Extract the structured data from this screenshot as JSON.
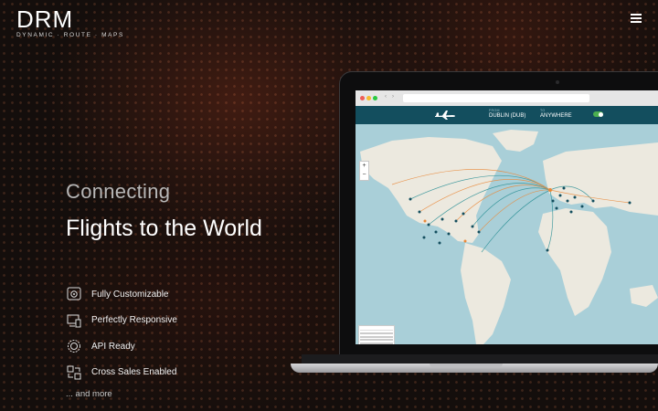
{
  "brand": {
    "name": "DRM",
    "tagline": "DYNAMIC · ROUTE · MAPS"
  },
  "hero": {
    "line1": "Connecting",
    "line2": "Flights to the World"
  },
  "features": [
    {
      "icon": "settings-screen-icon",
      "label": "Fully Customizable"
    },
    {
      "icon": "devices-icon",
      "label": "Perfectly Responsive"
    },
    {
      "icon": "api-gear-icon",
      "label": "API Ready"
    },
    {
      "icon": "cross-sales-icon",
      "label": "Cross Sales Enabled"
    }
  ],
  "more_link": "... and more",
  "mockup": {
    "url": "",
    "from_label": "FROM",
    "from_value": "DUBLIN (DUB)",
    "to_label": "TO",
    "to_value": "ANYWHERE",
    "zoom_in": "+",
    "zoom_out": "−"
  },
  "colors": {
    "accent": "#134e5e",
    "route_orange": "#e9893a",
    "route_teal": "#2a8f95",
    "background": "#140e0c"
  }
}
